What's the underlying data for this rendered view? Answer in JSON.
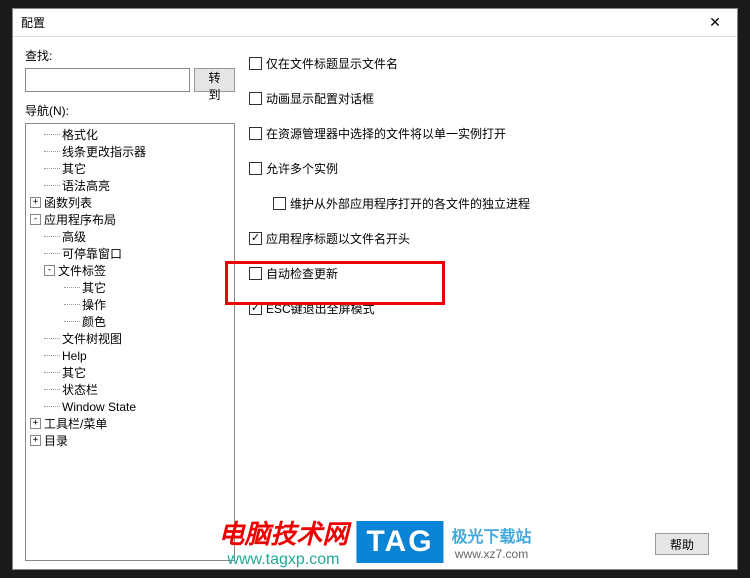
{
  "dialog": {
    "title": "配置",
    "close": "✕"
  },
  "sidebar": {
    "find_label": "查找:",
    "find_value": "",
    "goto_label": "转到",
    "nav_label": "导航(N):",
    "tree": [
      {
        "label": "格式化",
        "indent": 1,
        "toggle": null
      },
      {
        "label": "线条更改指示器",
        "indent": 1,
        "toggle": null
      },
      {
        "label": "其它",
        "indent": 1,
        "toggle": null
      },
      {
        "label": "语法高亮",
        "indent": 1,
        "toggle": null
      },
      {
        "label": "函数列表",
        "indent": 0,
        "toggle": "+"
      },
      {
        "label": "应用程序布局",
        "indent": 0,
        "toggle": "-"
      },
      {
        "label": "高级",
        "indent": 1,
        "toggle": null
      },
      {
        "label": "可停靠窗口",
        "indent": 1,
        "toggle": null
      },
      {
        "label": "文件标签",
        "indent": 1,
        "toggle": "-"
      },
      {
        "label": "其它",
        "indent": 2,
        "toggle": null
      },
      {
        "label": "操作",
        "indent": 2,
        "toggle": null
      },
      {
        "label": "颜色",
        "indent": 2,
        "toggle": null
      },
      {
        "label": "文件树视图",
        "indent": 1,
        "toggle": null
      },
      {
        "label": "Help",
        "indent": 1,
        "toggle": null
      },
      {
        "label": "其它",
        "indent": 1,
        "toggle": null
      },
      {
        "label": "状态栏",
        "indent": 1,
        "toggle": null
      },
      {
        "label": "Window State",
        "indent": 1,
        "toggle": null
      },
      {
        "label": "工具栏/菜单",
        "indent": 0,
        "toggle": "+"
      },
      {
        "label": "目录",
        "indent": 0,
        "toggle": "+"
      }
    ]
  },
  "options": [
    {
      "label": "仅在文件标题显示文件名",
      "checked": false,
      "indented": false
    },
    {
      "label": "动画显示配置对话框",
      "checked": false,
      "indented": false
    },
    {
      "label": "在资源管理器中选择的文件将以单一实例打开",
      "checked": false,
      "indented": false
    },
    {
      "label": "允许多个实例",
      "checked": false,
      "indented": false
    },
    {
      "label": "维护从外部应用程序打开的各文件的独立进程",
      "checked": false,
      "indented": true
    },
    {
      "label": "应用程序标题以文件名开头",
      "checked": true,
      "indented": false
    },
    {
      "label": "自动检查更新",
      "checked": false,
      "indented": false
    },
    {
      "label": "ESC键退出全屏模式",
      "checked": true,
      "indented": false
    }
  ],
  "buttons": {
    "help": "帮助"
  },
  "watermark": {
    "title": "电脑技术网",
    "url": "www.tagxp.com",
    "tag": "TAG",
    "right_top": "极光下载站",
    "right_bot": "www.xz7.com"
  }
}
